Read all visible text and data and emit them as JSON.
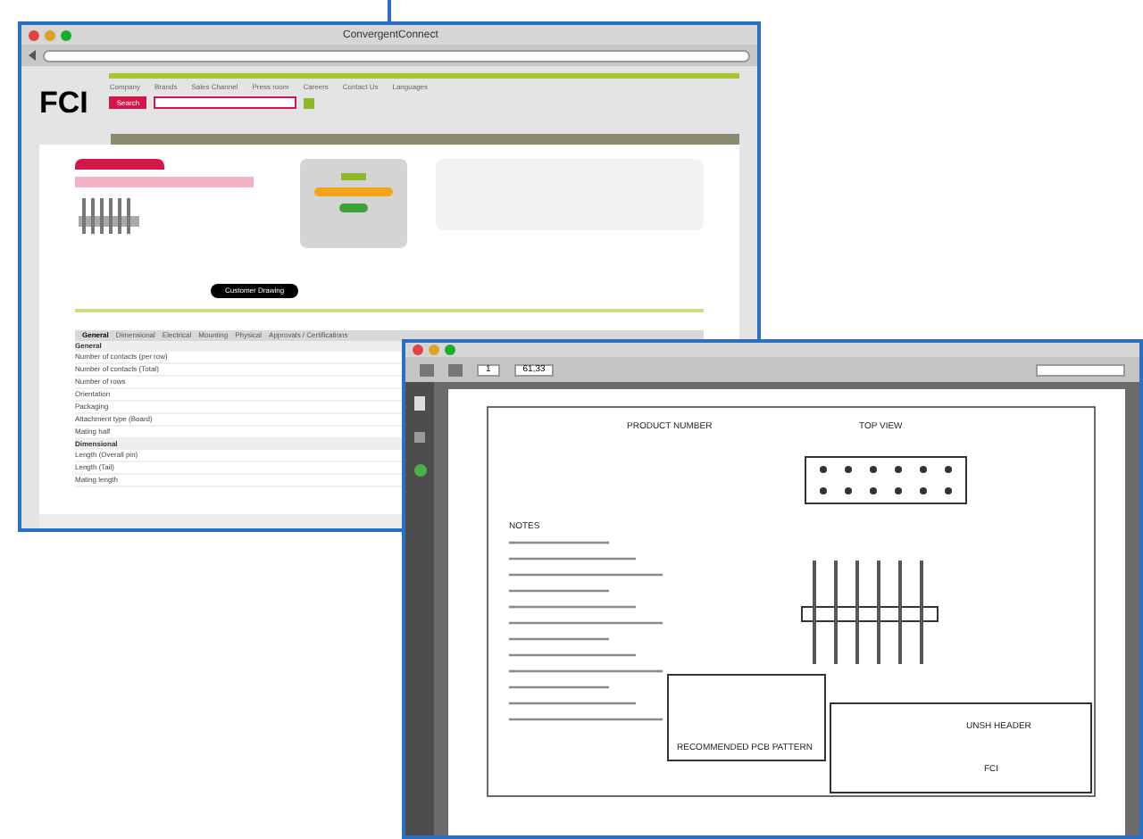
{
  "browser": {
    "title": "ConvergentConnect",
    "logo": "FCI",
    "search_label": "Search",
    "nav": [
      "Company",
      "Brands",
      "Sales Channel",
      "Press room",
      "Careers",
      "Contact Us",
      "Languages"
    ],
    "product_button": "Customer Drawing",
    "spec_tabs": [
      {
        "label": "General",
        "selected": true
      },
      {
        "label": "Dimensional",
        "selected": false
      },
      {
        "label": "Electrical",
        "selected": false
      },
      {
        "label": "Mounting",
        "selected": false
      },
      {
        "label": "Physical",
        "selected": false
      },
      {
        "label": "Approvals / Certifications",
        "selected": false
      }
    ],
    "spec_groups": [
      {
        "title": "General",
        "rows": [
          "Number of contacts (per row)",
          "Number of contacts (Total)",
          "Number of rows",
          "Orientation",
          "Packaging",
          "Attachment type (Board)",
          "Mating half"
        ]
      },
      {
        "title": "Dimensional",
        "rows": [
          "Length (Overall pin)",
          "Length (Tail)",
          "Mating length"
        ]
      }
    ]
  },
  "pdf_viewer": {
    "page": "1",
    "zoom": "61,33",
    "drawing": {
      "product_number": "PRODUCT NUMBER",
      "top_view": "TOP VIEW",
      "notes": "NOTES",
      "pcb_pattern": "RECOMMENDED PCB PATTERN",
      "title_block": "UNSH HEADER",
      "logo": "FCI"
    }
  }
}
